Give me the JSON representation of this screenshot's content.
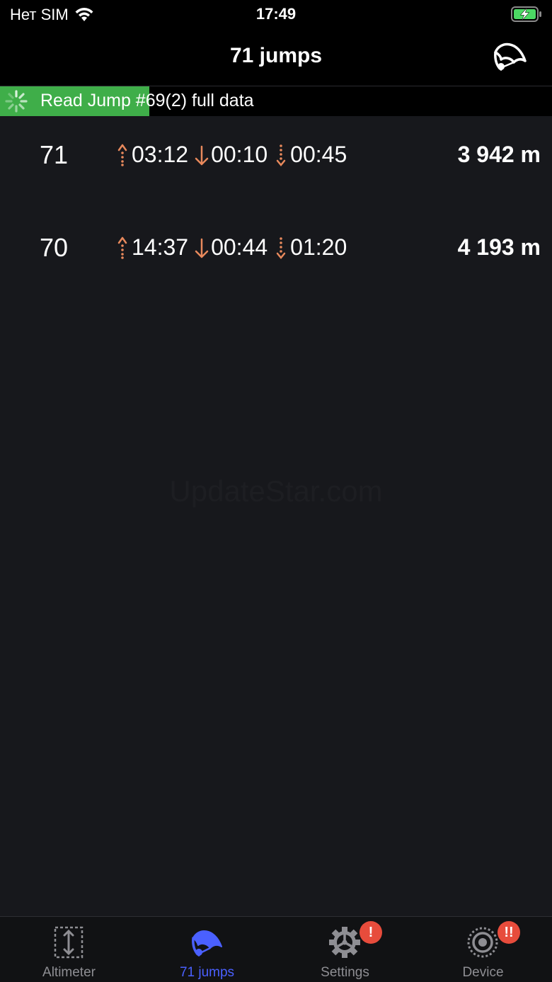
{
  "status": {
    "carrier": "Нет SIM",
    "time": "17:49"
  },
  "nav": {
    "title": "71 jumps"
  },
  "progress": {
    "text": "Read Jump #69(2) full data",
    "fraction": 0.27,
    "color": "#3fae49"
  },
  "jumps": [
    {
      "number": "71",
      "climb": "03:12",
      "freefall": "00:10",
      "canopy": "00:45",
      "altitude": "3 942 m"
    },
    {
      "number": "70",
      "climb": "14:37",
      "freefall": "00:44",
      "canopy": "01:20",
      "altitude": "4 193 m"
    }
  ],
  "watermark": "UpdateStar.com",
  "tabs": [
    {
      "label": "Altimeter",
      "icon": "altimeter-icon"
    },
    {
      "label": "71 jumps",
      "icon": "parachute-icon",
      "active": true
    },
    {
      "label": "Settings",
      "icon": "gear-icon",
      "badge": "!"
    },
    {
      "label": "Device",
      "icon": "device-icon",
      "badge": "!!"
    }
  ],
  "colors": {
    "accent": "#4a60ff",
    "icon_orange": "#e8895c",
    "badge": "#e74c3c"
  }
}
